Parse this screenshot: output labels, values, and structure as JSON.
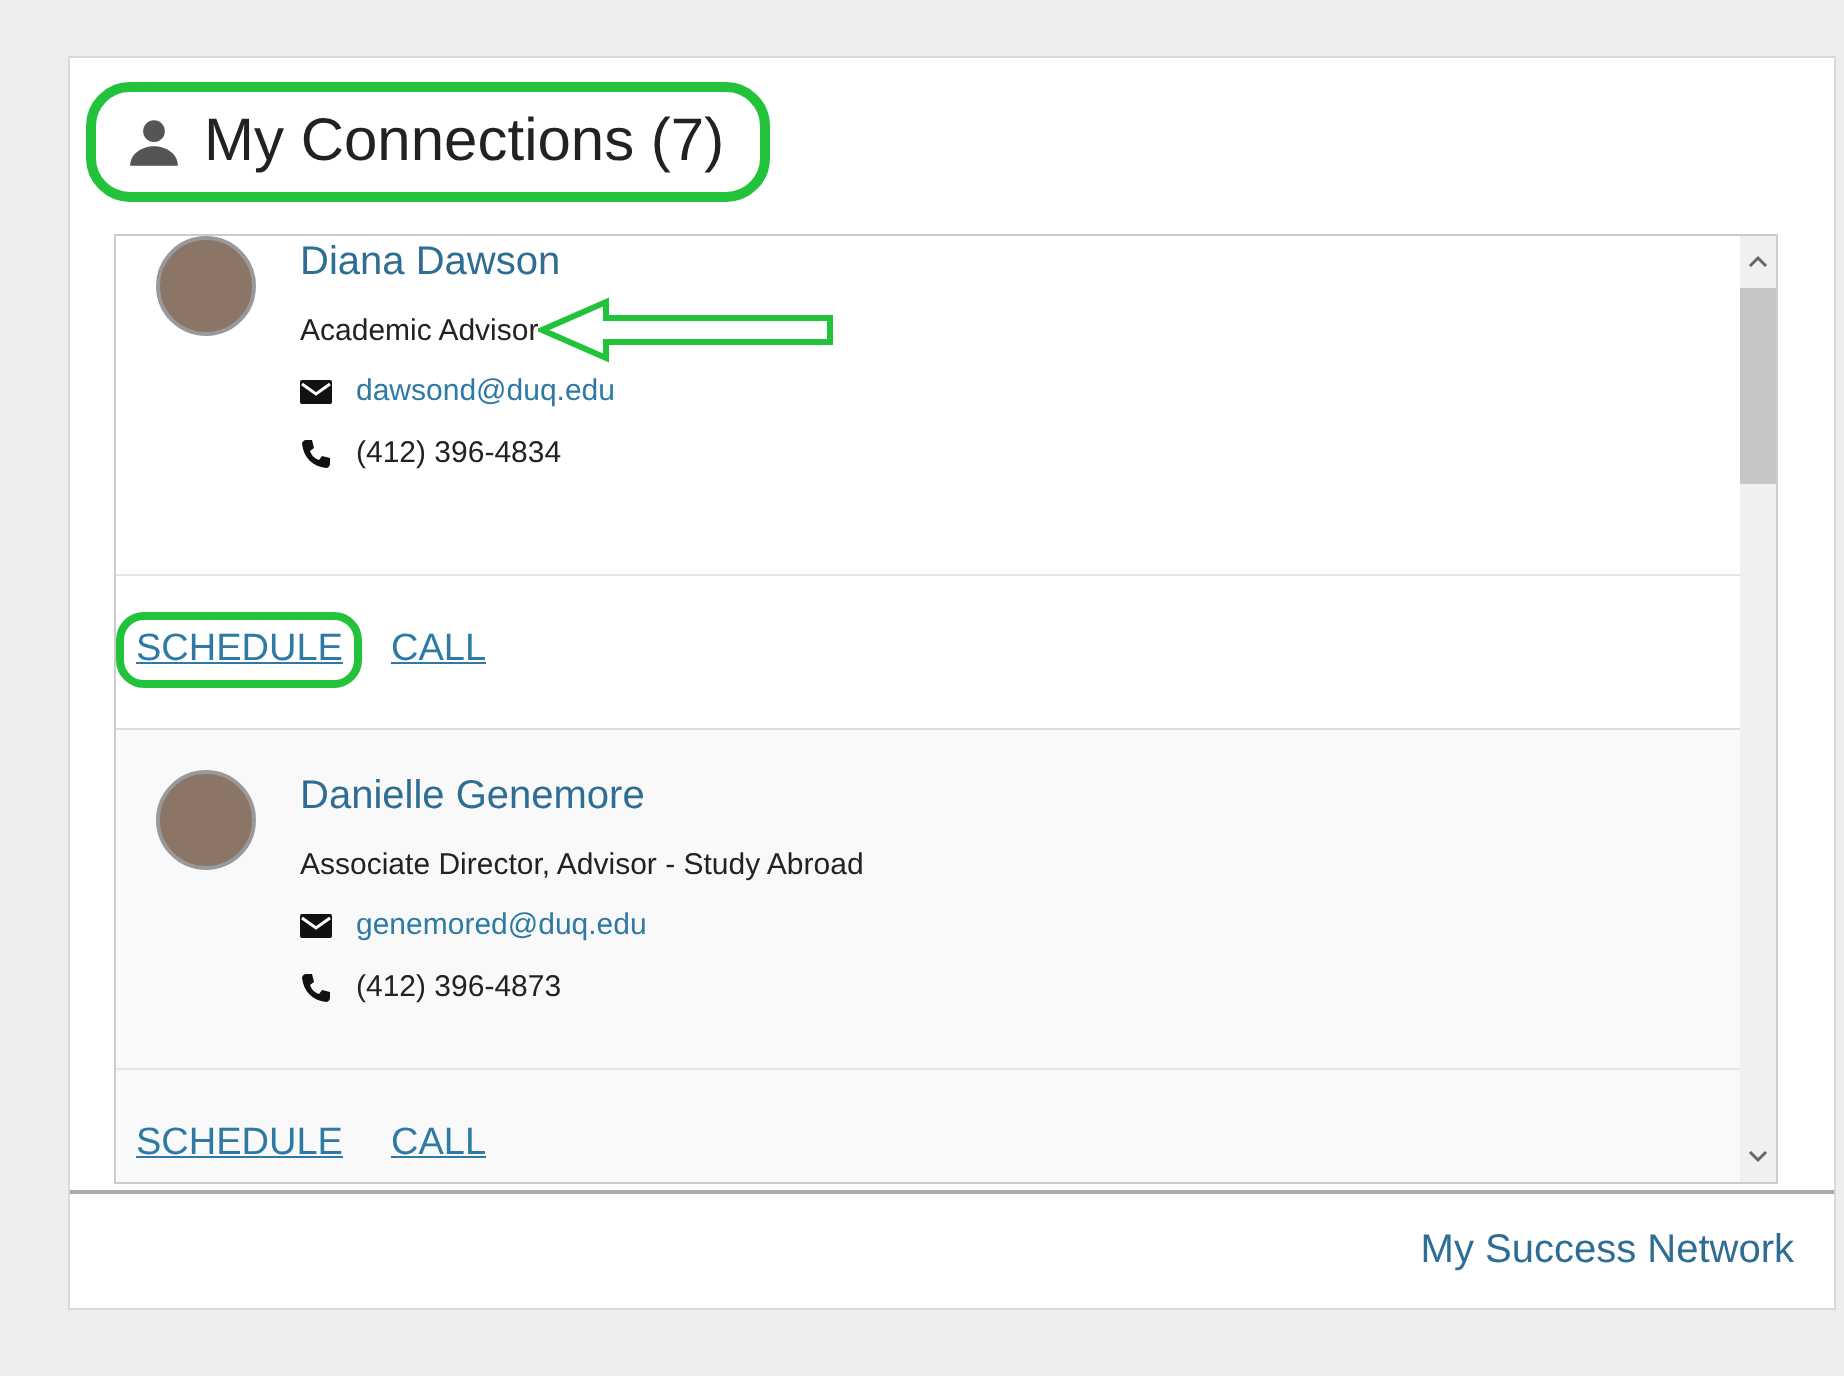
{
  "widget": {
    "title": "My Connections (7)",
    "title_highlighted": true
  },
  "connections": [
    {
      "name": "Diana Dawson",
      "role": "Academic Advisor",
      "role_arrow": true,
      "email": "dawsond@duq.edu",
      "phone": "(412) 396-4834",
      "shaded": false,
      "actions": [
        {
          "label": "SCHEDULE",
          "highlighted": true
        },
        {
          "label": "CALL",
          "highlighted": false
        }
      ]
    },
    {
      "name": "Danielle Genemore",
      "role": "Associate Director, Advisor - Study Abroad",
      "role_arrow": false,
      "email": "genemored@duq.edu",
      "phone": "(412) 396-4873",
      "shaded": true,
      "actions": [
        {
          "label": "SCHEDULE",
          "highlighted": false
        },
        {
          "label": "CALL",
          "highlighted": false
        }
      ]
    }
  ],
  "footer": {
    "link": "My Success Network"
  }
}
